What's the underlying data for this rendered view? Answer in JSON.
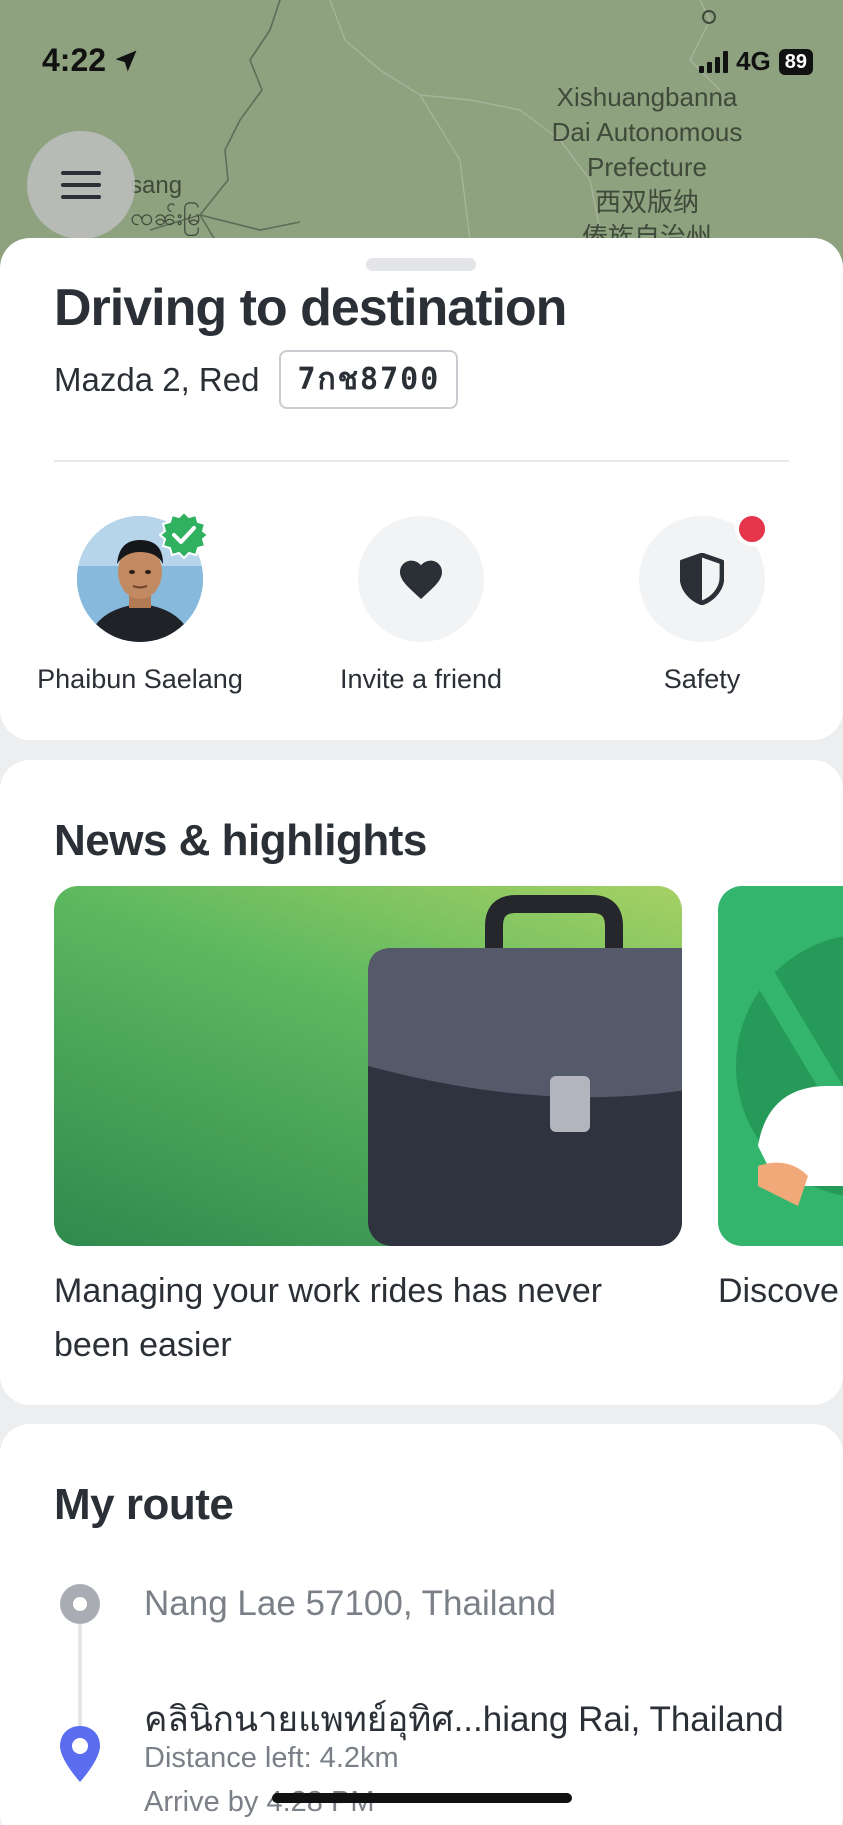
{
  "status_bar": {
    "time": "4:22",
    "network": "4G",
    "battery": "89"
  },
  "map": {
    "region_label_lines": [
      "Xishuangbanna",
      "Dai Autonomous",
      "Prefecture",
      "西双版纳",
      "傣族自治州"
    ],
    "left_label_lines": [
      "sang",
      "ၸၼ်းမြ"
    ],
    "background_color": "#8ea27f"
  },
  "trip": {
    "title": "Driving to destination",
    "car": "Mazda 2, Red",
    "plate": "7กช8700"
  },
  "actions": {
    "driver": {
      "label": "Phaibun Saelang",
      "verified": true
    },
    "invite": {
      "label": "Invite a friend"
    },
    "safety": {
      "label": "Safety",
      "has_notification": true
    }
  },
  "news": {
    "title": "News & highlights",
    "cards": [
      {
        "caption": "Managing your work rides has never been easier",
        "icon": "briefcase-illustration"
      },
      {
        "caption": "Discove",
        "icon": "person-illustration"
      }
    ]
  },
  "route": {
    "title": "My route",
    "origin": "Nang Lae 57100, Thailand",
    "destination": "คลินิกนายแพทย์อุทิศ...hiang Rai, Thailand",
    "distance_left": "Distance left: 4.2km",
    "arrive_by": "Arrive by 4:28 PM"
  },
  "colors": {
    "accent_green": "#2fb160",
    "notification_red": "#e5354a",
    "pin_blue": "#5a6df0"
  }
}
